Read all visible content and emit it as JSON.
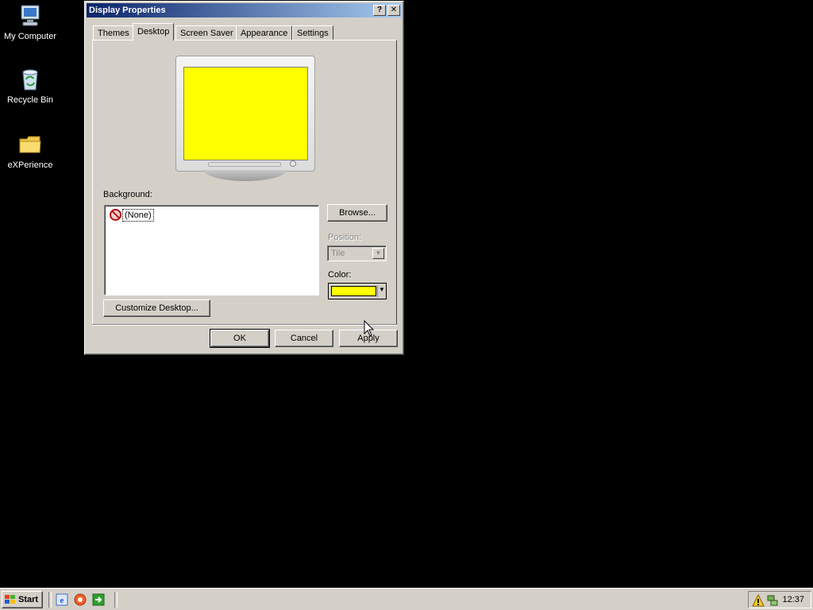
{
  "desktop": {
    "icons": [
      {
        "label": "My Computer",
        "icon": "my-computer-icon"
      },
      {
        "label": "Recycle Bin",
        "icon": "recycle-bin-icon"
      },
      {
        "label": "eXPerience",
        "icon": "folder-icon"
      }
    ],
    "background_color": "#000000"
  },
  "window": {
    "title": "Display Properties",
    "help_label": "?",
    "close_label": "✕",
    "tabs": [
      {
        "label": "Themes"
      },
      {
        "label": "Desktop",
        "active": true
      },
      {
        "label": "Screen Saver"
      },
      {
        "label": "Appearance"
      },
      {
        "label": "Settings"
      }
    ],
    "preview_color": "#ffff00",
    "background_label": "Background:",
    "background_items": [
      {
        "label": "(None)",
        "icon": "no-background-icon",
        "selected": true
      }
    ],
    "browse_label": "Browse...",
    "position_label": "Position:",
    "position_value": "Tile",
    "color_label": "Color:",
    "selected_color": "#ffff00",
    "customize_label": "Customize Desktop...",
    "ok_label": "OK",
    "cancel_label": "Cancel",
    "apply_label": "Apply"
  },
  "taskbar": {
    "start_label": "Start",
    "quick_launch": [
      "internet-explorer-icon",
      "media-icon",
      "show-desktop-icon"
    ],
    "tray_icons": [
      "warning-icon",
      "network-icon"
    ],
    "clock": "12:37"
  }
}
